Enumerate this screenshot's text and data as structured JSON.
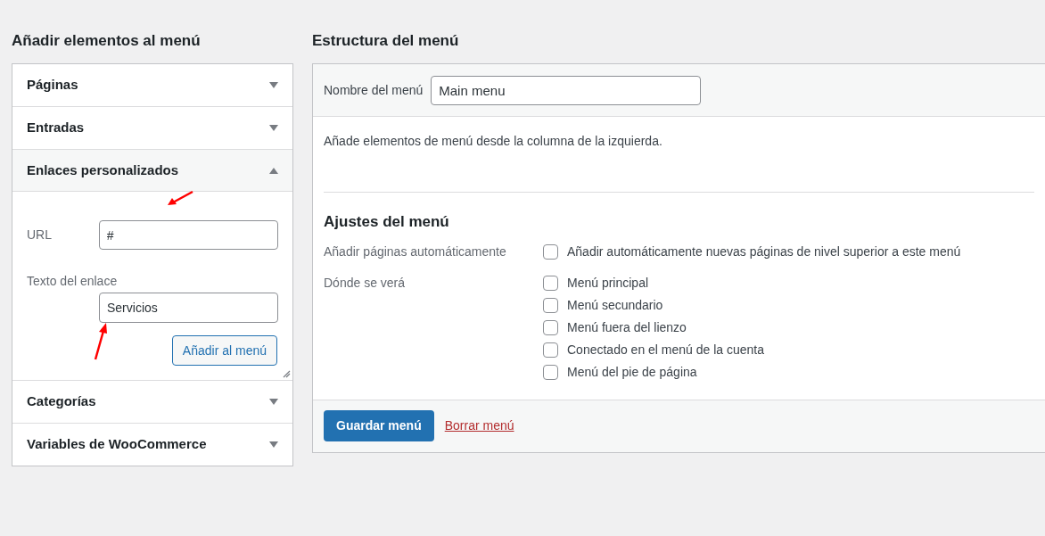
{
  "left_panel": {
    "title": "Añadir elementos al menú",
    "sections": [
      {
        "title": "Páginas",
        "expanded": false
      },
      {
        "title": "Entradas",
        "expanded": false
      },
      {
        "title": "Enlaces personalizados",
        "expanded": true,
        "form": {
          "url_label": "URL",
          "url_value": "#",
          "text_label": "Texto del enlace",
          "text_value": "Servicios",
          "button": "Añadir al menú"
        }
      },
      {
        "title": "Categorías",
        "expanded": false
      },
      {
        "title": "Variables de WooCommerce",
        "expanded": false
      }
    ]
  },
  "right_panel": {
    "title": "Estructura del menú",
    "menu_name": {
      "label": "Nombre del menú",
      "value": "Main menu"
    },
    "instructions": "Añade elementos de menú desde la columna de la izquierda.",
    "settings": {
      "title": "Ajustes del menú",
      "groups": [
        {
          "label": "Añadir páginas automáticamente",
          "options": [
            {
              "label": "Añadir automáticamente nuevas páginas de nivel superior a este menú",
              "checked": false
            }
          ]
        },
        {
          "label": "Dónde se verá",
          "options": [
            {
              "label": "Menú principal",
              "checked": false
            },
            {
              "label": "Menú secundario",
              "checked": false
            },
            {
              "label": "Menú fuera del lienzo",
              "checked": false
            },
            {
              "label": "Conectado en el menú de la cuenta",
              "checked": false
            },
            {
              "label": "Menú del pie de página",
              "checked": false
            }
          ]
        }
      ]
    },
    "footer": {
      "save_button": "Guardar menú",
      "delete_link": "Borrar menú"
    }
  }
}
